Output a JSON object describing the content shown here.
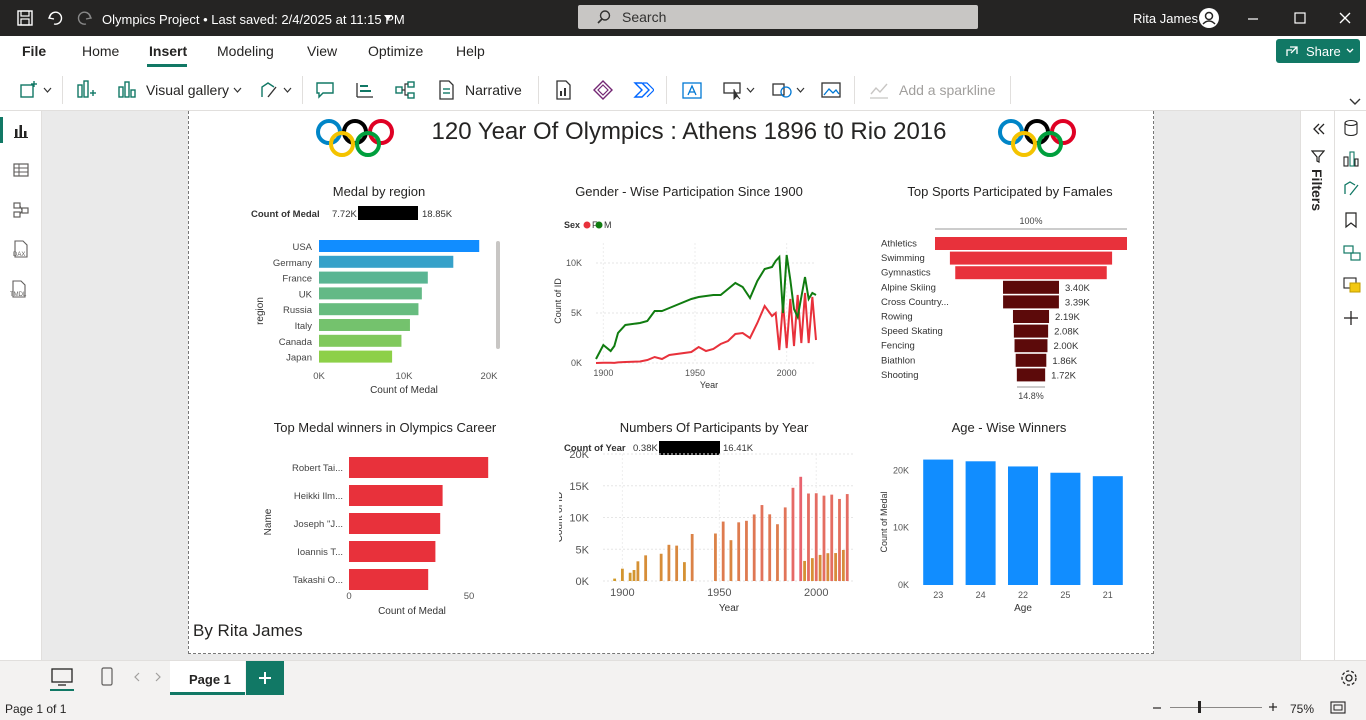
{
  "titlebar": {
    "title": "Olympics Project • Last saved: 2/4/2025 at 11:15 PM",
    "search_placeholder": "Search",
    "user": "Rita James"
  },
  "menu": {
    "file": "File",
    "tabs": [
      "Home",
      "Insert",
      "Modeling",
      "View",
      "Optimize",
      "Help"
    ],
    "share": "Share"
  },
  "toolbar": {
    "visual_gallery": "Visual gallery",
    "narrative": "Narrative",
    "sparkline": "Add a sparkline"
  },
  "report": {
    "title": "120 Year Of Olympics : Athens 1896 t0 Rio 2016",
    "footer": "By Rita James"
  },
  "filters": {
    "label": "Filters"
  },
  "pages": {
    "page1": "Page 1"
  },
  "status": {
    "page_info": "Page 1 of 1",
    "zoom": "75%"
  },
  "colors": {
    "blue": "#118dff",
    "red": "#e8313b",
    "green": "#107c10",
    "maroon": "#5c0a0a"
  },
  "chart_data": [
    {
      "type": "bar",
      "title": "Medal by region",
      "xlabel": "Count of Medal",
      "ylabel": "region",
      "legend": {
        "label": "Count of Medal",
        "min": "7.72K",
        "max": "18.85K"
      },
      "categories": [
        "USA",
        "Germany",
        "France",
        "UK",
        "Russia",
        "Italy",
        "Canada",
        "Japan"
      ],
      "values": [
        18850,
        15800,
        12800,
        12100,
        11700,
        10700,
        9700,
        8600
      ],
      "xticks": [
        "0K",
        "10K",
        "20K"
      ],
      "xlim": [
        0,
        20000
      ]
    },
    {
      "type": "line",
      "title": "Gender - Wise Participation Since 1900",
      "xlabel": "Year",
      "ylabel": "Count of ID",
      "legend": {
        "label": "Sex",
        "items": [
          "F",
          "M"
        ]
      },
      "xticks": [
        "1900",
        "1950",
        "2000"
      ],
      "yticks": [
        "0K",
        "5K",
        "10K"
      ],
      "xlim": [
        1896,
        2016
      ],
      "ylim": [
        0,
        12000
      ],
      "x": [
        1896,
        1900,
        1904,
        1906,
        1908,
        1912,
        1920,
        1924,
        1928,
        1932,
        1936,
        1948,
        1952,
        1956,
        1960,
        1964,
        1968,
        1972,
        1976,
        1980,
        1984,
        1988,
        1992,
        1994,
        1996,
        1998,
        2000,
        2002,
        2004,
        2006,
        2008,
        2010,
        2012,
        2014,
        2016
      ],
      "series": [
        {
          "name": "F",
          "values": [
            0,
            30,
            20,
            10,
            60,
            100,
            150,
            300,
            600,
            400,
            800,
            1100,
            1600,
            1200,
            1400,
            1900,
            2200,
            2900,
            3000,
            2500,
            4000,
            5700,
            4700,
            5000,
            1300,
            6000,
            1500,
            6400,
            1700,
            6800,
            2000,
            7000,
            2000,
            6600,
            2300
          ]
        },
        {
          "name": "M",
          "values": [
            400,
            1800,
            1200,
            1700,
            3000,
            3800,
            4000,
            4200,
            5200,
            5200,
            5500,
            6400,
            6600,
            6700,
            6800,
            6800,
            7400,
            8000,
            7600,
            6500,
            8200,
            9400,
            9600,
            10200,
            10600,
            5000,
            10800,
            8300,
            5400,
            4600,
            6600,
            8600,
            6400,
            7000,
            6800
          ]
        }
      ]
    },
    {
      "type": "bar",
      "title": "Top Sports Participated by Famales",
      "categories": [
        "Athletics",
        "Swimming",
        "Gymnastics",
        "Alpine Skiing",
        "Cross Country...",
        "Rowing",
        "Speed Skating",
        "Fencing",
        "Biathlon",
        "Shooting"
      ],
      "values": [
        11660,
        9850,
        9200,
        3400,
        3390,
        2190,
        2080,
        2000,
        1860,
        1720
      ],
      "labels": [
        "",
        "",
        "",
        "3.40K",
        "3.39K",
        "2.19K",
        "2.08K",
        "2.00K",
        "1.86K",
        "1.72K"
      ],
      "top_label": "100%",
      "bottom_label": "14.8%"
    },
    {
      "type": "bar",
      "title": "Top Medal winners in Olympics Career",
      "xlabel": "Count of Medal",
      "ylabel": "Name",
      "categories": [
        "Robert Tai...",
        "Heikki Ilm...",
        "Joseph \"J...",
        "Ioannis T...",
        "Takashi O..."
      ],
      "values": [
        58,
        39,
        38,
        36,
        33
      ],
      "xticks": [
        "0",
        "50"
      ],
      "xlim": [
        0,
        60
      ]
    },
    {
      "type": "bar",
      "title": "Numbers Of Participants by Year",
      "xlabel": "Year",
      "ylabel": "Count of ID",
      "legend": {
        "label": "Count of Year",
        "min": "0.38K",
        "max": "16.41K"
      },
      "xticks": [
        "1900",
        "1950",
        "2000"
      ],
      "yticks": [
        "0K",
        "5K",
        "10K",
        "15K",
        "20K"
      ],
      "xlim": [
        1890,
        2020
      ],
      "ylim": [
        0,
        20000
      ],
      "x": [
        1896,
        1900,
        1904,
        1906,
        1908,
        1912,
        1920,
        1924,
        1928,
        1932,
        1936,
        1948,
        1952,
        1956,
        1960,
        1964,
        1968,
        1972,
        1976,
        1980,
        1984,
        1988,
        1992,
        1994,
        1996,
        1998,
        2000,
        2002,
        2004,
        2006,
        2008,
        2010,
        2012,
        2014,
        2016
      ],
      "values": [
        380,
        1940,
        1300,
        1730,
        3100,
        4040,
        4290,
        5700,
        5570,
        2970,
        7400,
        7480,
        9360,
        6430,
        9240,
        9480,
        10480,
        11960,
        10500,
        8940,
        11590,
        14680,
        16410,
        3160,
        13780,
        3600,
        13820,
        4110,
        13440,
        4380,
        13600,
        4400,
        12920,
        4890,
        13690
      ]
    },
    {
      "type": "bar",
      "title": "Age - Wise Winners",
      "xlabel": "Age",
      "ylabel": "Count of Medal",
      "categories": [
        "23",
        "24",
        "22",
        "25",
        "21"
      ],
      "values": [
        21900,
        21600,
        20700,
        19600,
        19000
      ],
      "yticks": [
        "0K",
        "10K",
        "20K"
      ],
      "ylim": [
        0,
        22000
      ]
    }
  ]
}
